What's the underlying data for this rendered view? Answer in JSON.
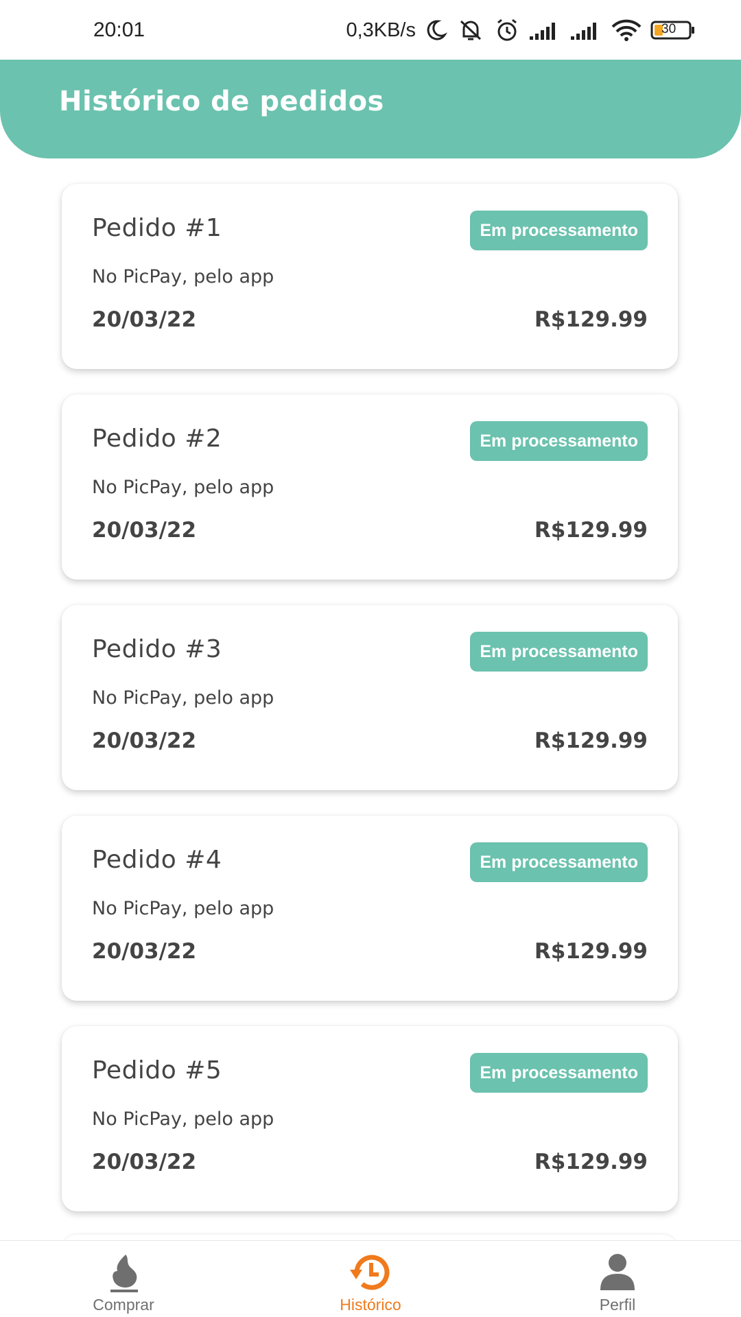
{
  "status_bar": {
    "time": "20:01",
    "speed": "0,3KB/s",
    "battery": "30",
    "icons": [
      "moon-icon",
      "bell-muted-icon",
      "alarm-icon",
      "signal-icon",
      "signal-icon",
      "wifi-icon",
      "battery-icon"
    ]
  },
  "header": {
    "title": "Histórico de pedidos"
  },
  "orders": [
    {
      "title": "Pedido #1",
      "status": "Em processamento",
      "method": "No PicPay, pelo app",
      "date": "20/03/22",
      "price": "R$129.99"
    },
    {
      "title": "Pedido #2",
      "status": "Em processamento",
      "method": "No PicPay, pelo app",
      "date": "20/03/22",
      "price": "R$129.99"
    },
    {
      "title": "Pedido #3",
      "status": "Em processamento",
      "method": "No PicPay, pelo app",
      "date": "20/03/22",
      "price": "R$129.99"
    },
    {
      "title": "Pedido #4",
      "status": "Em processamento",
      "method": "No PicPay, pelo app",
      "date": "20/03/22",
      "price": "R$129.99"
    },
    {
      "title": "Pedido #5",
      "status": "Em processamento",
      "method": "No PicPay, pelo app",
      "date": "20/03/22",
      "price": "R$129.99"
    }
  ],
  "bottom_nav": {
    "items": [
      {
        "label": "Comprar",
        "icon": "flame-icon",
        "active": false
      },
      {
        "label": "Histórico",
        "icon": "history-icon",
        "active": true
      },
      {
        "label": "Perfil",
        "icon": "person-icon",
        "active": false
      }
    ]
  },
  "colors": {
    "accent": "#6bc2ae",
    "active_nav": "#f07a1c",
    "text": "#444444"
  }
}
